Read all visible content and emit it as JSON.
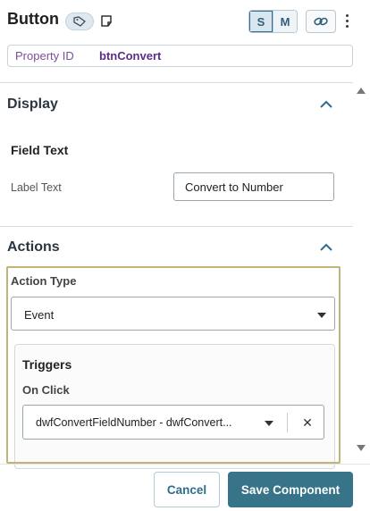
{
  "header": {
    "title": "Button",
    "tag_icon": "tag-icon",
    "note_icon": "note-icon",
    "size_options": [
      "S",
      "M"
    ],
    "selected_size": "S",
    "link_icon": "link-icon",
    "more_icon": "more-vertical-icon"
  },
  "property": {
    "label": "Property ID",
    "value": "btnConvert"
  },
  "display": {
    "title": "Display",
    "field_text_heading": "Field Text",
    "label_text_label": "Label Text",
    "label_text_value": "Convert to Number"
  },
  "actions": {
    "title": "Actions",
    "action_type_label": "Action Type",
    "action_type_value": "Event",
    "triggers_title": "Triggers",
    "on_click_label": "On Click",
    "on_click_value": "dwfConvertFieldNumber - dwfConvert...",
    "clear_symbol": "✕"
  },
  "footer": {
    "cancel_label": "Cancel",
    "save_label": "Save Component"
  },
  "colors": {
    "accent": "#387489",
    "property_label": "#7a4f9a",
    "property_value": "#5b2d86",
    "highlight_border": "#c2b377"
  }
}
